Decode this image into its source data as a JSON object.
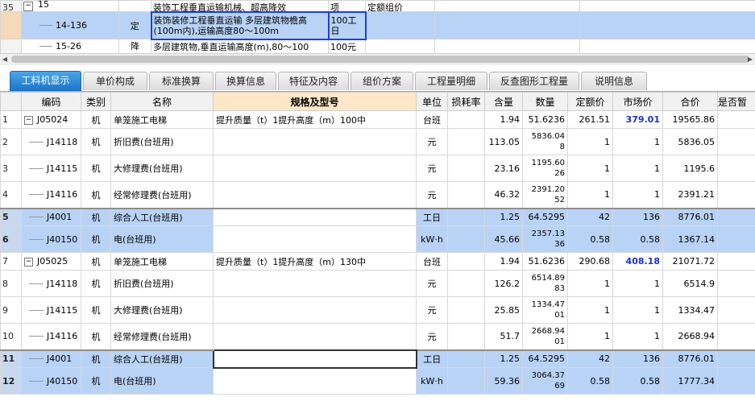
{
  "top_rows": [
    {
      "num": "35",
      "code": "15",
      "type": "",
      "name": "装饰工程垂直运输机械、超高降效",
      "unit": "项",
      "extra": "定额组价"
    },
    {
      "num": "",
      "code": "14-136",
      "type": "定",
      "name": "装饰装修工程垂直运输 多层建筑物檐高(100m内),运输高度80～100m",
      "unit": "100工日",
      "extra": ""
    },
    {
      "num": "",
      "code": "15-26",
      "type": "降",
      "name": "多层建筑物,垂直运输高度(m),80～100",
      "unit": "100元",
      "extra": ""
    }
  ],
  "tabs": [
    "工料机显示",
    "单价构成",
    "标准换算",
    "换算信息",
    "特征及内容",
    "组价方案",
    "工程量明细",
    "反查图形工程量",
    "说明信息"
  ],
  "columns": [
    "编码",
    "类别",
    "名称",
    "规格及型号",
    "单位",
    "损耗率",
    "含量",
    "数量",
    "定额价",
    "市场价",
    "合价",
    "是否暂"
  ],
  "rows": [
    {
      "rn": "1",
      "code": "J05024",
      "type": "机",
      "name": "单笼施工电梯",
      "spec": "提升质量（t）1提升高度（m）100中",
      "unit": "台班",
      "loss": "",
      "qty": "1.94",
      "amount": "51.6236",
      "quota": "261.51",
      "market": "379.01",
      "total": "19565.86"
    },
    {
      "rn": "2",
      "code": "J14118",
      "type": "机",
      "name": "折旧费(台班用)",
      "spec": "",
      "unit": "元",
      "loss": "",
      "qty": "113.05",
      "amount": "5836.048",
      "quota": "1",
      "market": "1",
      "total": "5836.05"
    },
    {
      "rn": "3",
      "code": "J14115",
      "type": "机",
      "name": "大修理费(台班用)",
      "spec": "",
      "unit": "元",
      "loss": "",
      "qty": "23.16",
      "amount": "1195.6026",
      "quota": "1",
      "market": "1",
      "total": "1195.6"
    },
    {
      "rn": "4",
      "code": "J14116",
      "type": "机",
      "name": "经常修理费(台班用)",
      "spec": "",
      "unit": "元",
      "loss": "",
      "qty": "46.32",
      "amount": "2391.2052",
      "quota": "1",
      "market": "1",
      "total": "2391.21"
    },
    {
      "rn": "5",
      "code": "J4001",
      "type": "机",
      "name": "综合人工(台班用)",
      "spec": "",
      "unit": "工日",
      "loss": "",
      "qty": "1.25",
      "amount": "64.5295",
      "quota": "42",
      "market": "136",
      "total": "8776.01"
    },
    {
      "rn": "6",
      "code": "J40150",
      "type": "机",
      "name": "电(台班用)",
      "spec": "",
      "unit": "kW·h",
      "loss": "",
      "qty": "45.66",
      "amount": "2357.1336",
      "quota": "0.58",
      "market": "0.58",
      "total": "1367.14"
    },
    {
      "rn": "7",
      "code": "J05025",
      "type": "机",
      "name": "单笼施工电梯",
      "spec": "提升质量（t）1提升高度（m）130中",
      "unit": "台班",
      "loss": "",
      "qty": "1.94",
      "amount": "51.6236",
      "quota": "290.68",
      "market": "408.18",
      "total": "21071.72"
    },
    {
      "rn": "8",
      "code": "J14118",
      "type": "机",
      "name": "折旧费(台班用)",
      "spec": "",
      "unit": "元",
      "loss": "",
      "qty": "126.2",
      "amount": "6514.8983",
      "quota": "1",
      "market": "1",
      "total": "6514.9"
    },
    {
      "rn": "9",
      "code": "J14115",
      "type": "机",
      "name": "大修理费(台班用)",
      "spec": "",
      "unit": "元",
      "loss": "",
      "qty": "25.85",
      "amount": "1334.4701",
      "quota": "1",
      "market": "1",
      "total": "1334.47"
    },
    {
      "rn": "10",
      "code": "J14116",
      "type": "机",
      "name": "经常修理费(台班用)",
      "spec": "",
      "unit": "元",
      "loss": "",
      "qty": "51.7",
      "amount": "2668.9401",
      "quota": "1",
      "market": "1",
      "total": "2668.94"
    },
    {
      "rn": "11",
      "code": "J4001",
      "type": "机",
      "name": "综合人工(台班用)",
      "spec": "",
      "unit": "工日",
      "loss": "",
      "qty": "1.25",
      "amount": "64.5295",
      "quota": "42",
      "market": "136",
      "total": "8776.01"
    },
    {
      "rn": "12",
      "code": "J40150",
      "type": "机",
      "name": "电(台班用)",
      "spec": "",
      "unit": "kW·h",
      "loss": "",
      "qty": "59.36",
      "amount": "3064.3769",
      "quota": "0.58",
      "market": "0.58",
      "total": "1777.34"
    }
  ],
  "amount_split": {
    "2": [
      "5836.04",
      "8"
    ],
    "3": [
      "1195.60",
      "26"
    ],
    "4": [
      "2391.20",
      "52"
    ],
    "6": [
      "2357.13",
      "36"
    ],
    "8": [
      "6514.89",
      "83"
    ],
    "9": [
      "1334.47",
      "01"
    ],
    "10": [
      "2668.94",
      "01"
    ],
    "12": [
      "3064.37",
      "69"
    ]
  },
  "icons": {
    "collapse": "minus-box-icon",
    "arrow_left": "arrow-left-icon",
    "arrow_right": "arrow-right-icon"
  },
  "colors": {
    "selected_row": "#b9d3f7",
    "active_tab": "#1c74c6",
    "market_price_highlight": "#1a33c6",
    "spec_header": "#fde7c7"
  }
}
